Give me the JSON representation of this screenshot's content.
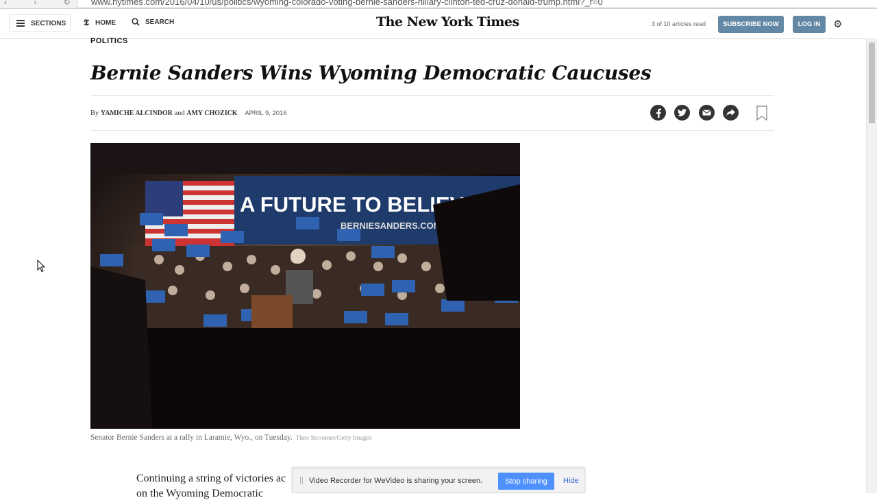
{
  "browser": {
    "url": "www.nytimes.com/2016/04/10/us/politics/wyoming-colorado-voting-bernie-sanders-hillary-clinton-ted-cruz-donald-trump.html?_r=0"
  },
  "header": {
    "sections_label": "SECTIONS",
    "home_label": "HOME",
    "home_icon": "t-logo-icon",
    "search_label": "SEARCH",
    "logo": "The New York Times",
    "meter": "3 of 10 articles read",
    "subscribe_label": "SUBSCRIBE NOW",
    "login_label": "LOG IN",
    "accent_color": "#6288a5"
  },
  "article": {
    "kicker": "POLITICS",
    "headline": "Bernie Sanders Wins Wyoming Democratic Caucuses",
    "byline_prefix": "By ",
    "author1": "Yamiche Alcindor",
    "byline_and": " and ",
    "author2": "Amy Chozick",
    "date": "APRIL 9, 2016",
    "share_icons": [
      "facebook-icon",
      "twitter-icon",
      "email-icon",
      "share-icon",
      "bookmark-icon"
    ],
    "photo": {
      "banner_text": "A FUTURE TO BELIEVE",
      "banner_url": "BERNIESANDERS.COM",
      "sign_text": "A FUTURE TO BELIEVE IN"
    },
    "caption": "Senator Bernie Sanders at a rally in Laramie, Wyo., on Tuesday.",
    "credit": "Theo Stroomer/Getty Images",
    "body_line1": "Continuing a string of victories ac",
    "body_line2": "on the Wyoming Democratic"
  },
  "screen_share": {
    "message": "Video Recorder for WeVideo is sharing your screen.",
    "stop_label": "Stop sharing",
    "hide_label": "Hide"
  }
}
